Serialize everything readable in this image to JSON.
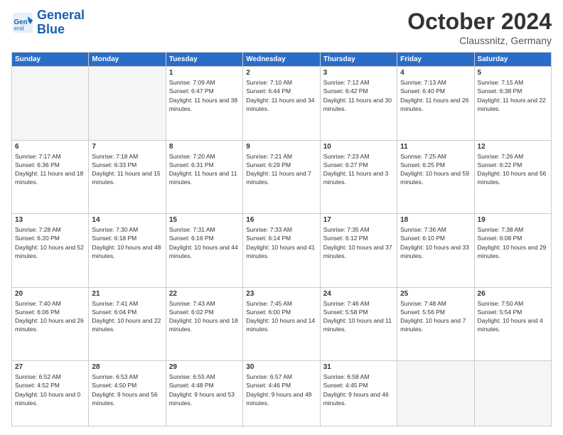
{
  "header": {
    "logo_line1": "General",
    "logo_line2": "Blue",
    "month": "October 2024",
    "location": "Claussnitz, Germany"
  },
  "weekdays": [
    "Sunday",
    "Monday",
    "Tuesday",
    "Wednesday",
    "Thursday",
    "Friday",
    "Saturday"
  ],
  "weeks": [
    [
      {
        "day": "",
        "info": ""
      },
      {
        "day": "",
        "info": ""
      },
      {
        "day": "1",
        "info": "Sunrise: 7:09 AM\nSunset: 6:47 PM\nDaylight: 11 hours and 38 minutes."
      },
      {
        "day": "2",
        "info": "Sunrise: 7:10 AM\nSunset: 6:44 PM\nDaylight: 11 hours and 34 minutes."
      },
      {
        "day": "3",
        "info": "Sunrise: 7:12 AM\nSunset: 6:42 PM\nDaylight: 11 hours and 30 minutes."
      },
      {
        "day": "4",
        "info": "Sunrise: 7:13 AM\nSunset: 6:40 PM\nDaylight: 11 hours and 26 minutes."
      },
      {
        "day": "5",
        "info": "Sunrise: 7:15 AM\nSunset: 6:38 PM\nDaylight: 11 hours and 22 minutes."
      }
    ],
    [
      {
        "day": "6",
        "info": "Sunrise: 7:17 AM\nSunset: 6:36 PM\nDaylight: 11 hours and 18 minutes."
      },
      {
        "day": "7",
        "info": "Sunrise: 7:18 AM\nSunset: 6:33 PM\nDaylight: 11 hours and 15 minutes."
      },
      {
        "day": "8",
        "info": "Sunrise: 7:20 AM\nSunset: 6:31 PM\nDaylight: 11 hours and 11 minutes."
      },
      {
        "day": "9",
        "info": "Sunrise: 7:21 AM\nSunset: 6:29 PM\nDaylight: 11 hours and 7 minutes."
      },
      {
        "day": "10",
        "info": "Sunrise: 7:23 AM\nSunset: 6:27 PM\nDaylight: 11 hours and 3 minutes."
      },
      {
        "day": "11",
        "info": "Sunrise: 7:25 AM\nSunset: 6:25 PM\nDaylight: 10 hours and 59 minutes."
      },
      {
        "day": "12",
        "info": "Sunrise: 7:26 AM\nSunset: 6:22 PM\nDaylight: 10 hours and 56 minutes."
      }
    ],
    [
      {
        "day": "13",
        "info": "Sunrise: 7:28 AM\nSunset: 6:20 PM\nDaylight: 10 hours and 52 minutes."
      },
      {
        "day": "14",
        "info": "Sunrise: 7:30 AM\nSunset: 6:18 PM\nDaylight: 10 hours and 48 minutes."
      },
      {
        "day": "15",
        "info": "Sunrise: 7:31 AM\nSunset: 6:16 PM\nDaylight: 10 hours and 44 minutes."
      },
      {
        "day": "16",
        "info": "Sunrise: 7:33 AM\nSunset: 6:14 PM\nDaylight: 10 hours and 41 minutes."
      },
      {
        "day": "17",
        "info": "Sunrise: 7:35 AM\nSunset: 6:12 PM\nDaylight: 10 hours and 37 minutes."
      },
      {
        "day": "18",
        "info": "Sunrise: 7:36 AM\nSunset: 6:10 PM\nDaylight: 10 hours and 33 minutes."
      },
      {
        "day": "19",
        "info": "Sunrise: 7:38 AM\nSunset: 6:08 PM\nDaylight: 10 hours and 29 minutes."
      }
    ],
    [
      {
        "day": "20",
        "info": "Sunrise: 7:40 AM\nSunset: 6:06 PM\nDaylight: 10 hours and 26 minutes."
      },
      {
        "day": "21",
        "info": "Sunrise: 7:41 AM\nSunset: 6:04 PM\nDaylight: 10 hours and 22 minutes."
      },
      {
        "day": "22",
        "info": "Sunrise: 7:43 AM\nSunset: 6:02 PM\nDaylight: 10 hours and 18 minutes."
      },
      {
        "day": "23",
        "info": "Sunrise: 7:45 AM\nSunset: 6:00 PM\nDaylight: 10 hours and 14 minutes."
      },
      {
        "day": "24",
        "info": "Sunrise: 7:46 AM\nSunset: 5:58 PM\nDaylight: 10 hours and 11 minutes."
      },
      {
        "day": "25",
        "info": "Sunrise: 7:48 AM\nSunset: 5:56 PM\nDaylight: 10 hours and 7 minutes."
      },
      {
        "day": "26",
        "info": "Sunrise: 7:50 AM\nSunset: 5:54 PM\nDaylight: 10 hours and 4 minutes."
      }
    ],
    [
      {
        "day": "27",
        "info": "Sunrise: 6:52 AM\nSunset: 4:52 PM\nDaylight: 10 hours and 0 minutes."
      },
      {
        "day": "28",
        "info": "Sunrise: 6:53 AM\nSunset: 4:50 PM\nDaylight: 9 hours and 56 minutes."
      },
      {
        "day": "29",
        "info": "Sunrise: 6:55 AM\nSunset: 4:48 PM\nDaylight: 9 hours and 53 minutes."
      },
      {
        "day": "30",
        "info": "Sunrise: 6:57 AM\nSunset: 4:46 PM\nDaylight: 9 hours and 49 minutes."
      },
      {
        "day": "31",
        "info": "Sunrise: 6:58 AM\nSunset: 4:45 PM\nDaylight: 9 hours and 46 minutes."
      },
      {
        "day": "",
        "info": ""
      },
      {
        "day": "",
        "info": ""
      }
    ]
  ]
}
